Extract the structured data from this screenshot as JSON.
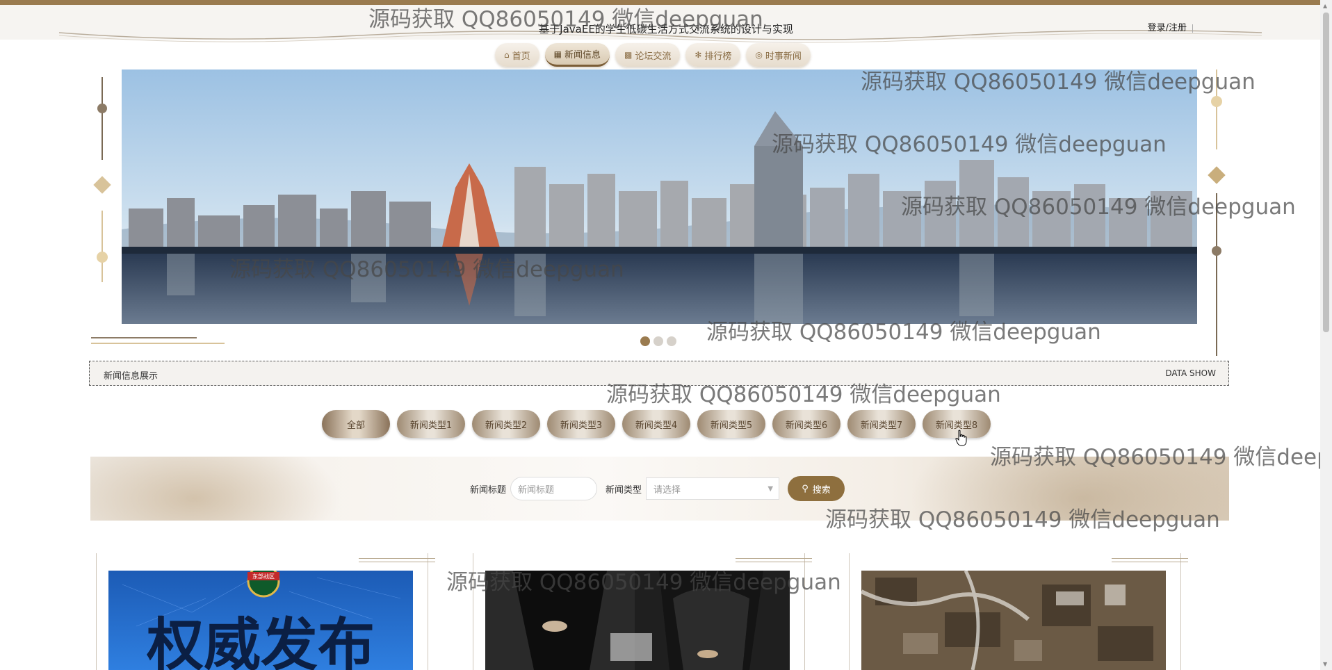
{
  "header": {
    "title": "基于JavaEE的学生低碳生活方式交流系统的设计与实现",
    "login_label": "登录/注册"
  },
  "nav": {
    "items": [
      {
        "label": "首页",
        "icon": "home-icon"
      },
      {
        "label": "新闻信息",
        "icon": "news-icon"
      },
      {
        "label": "论坛交流",
        "icon": "forum-icon"
      },
      {
        "label": "排行榜",
        "icon": "ranking-icon"
      },
      {
        "label": "时事新闻",
        "icon": "globe-icon"
      }
    ],
    "active_index": 1
  },
  "carousel": {
    "slide_count": 3,
    "active_slide": 1
  },
  "section": {
    "title": "新闻信息展示",
    "subtitle": "DATA SHOW"
  },
  "categories": {
    "items": [
      "全部",
      "新闻类型1",
      "新闻类型2",
      "新闻类型3",
      "新闻类型4",
      "新闻类型5",
      "新闻类型6",
      "新闻类型7",
      "新闻类型8"
    ],
    "active_index": 0
  },
  "search": {
    "title_label": "新闻标题",
    "title_placeholder": "新闻标题",
    "type_label": "新闻类型",
    "type_placeholder": "请选择",
    "button_label": "搜索"
  },
  "cards": [
    {
      "badge": "东部战区",
      "headline": "权威发布"
    },
    {},
    {}
  ],
  "watermark": "源码获取 QQ86050149 微信deepguan",
  "colors": {
    "accent": "#9a7b4f",
    "button": "#8e6f3e",
    "nav_text": "#8a6d45"
  }
}
